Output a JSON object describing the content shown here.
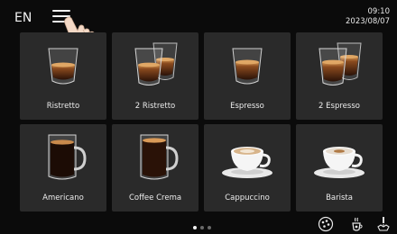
{
  "header": {
    "language": "EN",
    "time": "09:10",
    "date": "2023/08/07",
    "menu_icon": "hamburger-menu-icon",
    "pointer_icon": "hand-pointer-icon"
  },
  "drinks": [
    {
      "label": "Ristretto",
      "icon": "espresso-glass-icon"
    },
    {
      "label": "2 Ristretto",
      "icon": "double-espresso-glass-icon"
    },
    {
      "label": "Espresso",
      "icon": "espresso-glass-icon"
    },
    {
      "label": "2 Espresso",
      "icon": "double-espresso-glass-icon"
    },
    {
      "label": "Americano",
      "icon": "tall-glass-mug-icon"
    },
    {
      "label": "Coffee Crema",
      "icon": "tall-glass-mug-icon"
    },
    {
      "label": "Cappuccino",
      "icon": "cappuccino-cup-icon"
    },
    {
      "label": "Barista",
      "icon": "barista-cup-icon"
    }
  ],
  "pagination": {
    "pages": 3,
    "current": 1
  },
  "bottom_bar": [
    {
      "icon": "bean-selection-icon"
    },
    {
      "icon": "hot-water-icon"
    },
    {
      "icon": "rinse-icon"
    }
  ],
  "colors": {
    "background": "#0b0b0b",
    "tile": "#2a2a2a",
    "text": "#ececec",
    "coffee": "#6b3a1a",
    "crema": "#c8864a"
  }
}
